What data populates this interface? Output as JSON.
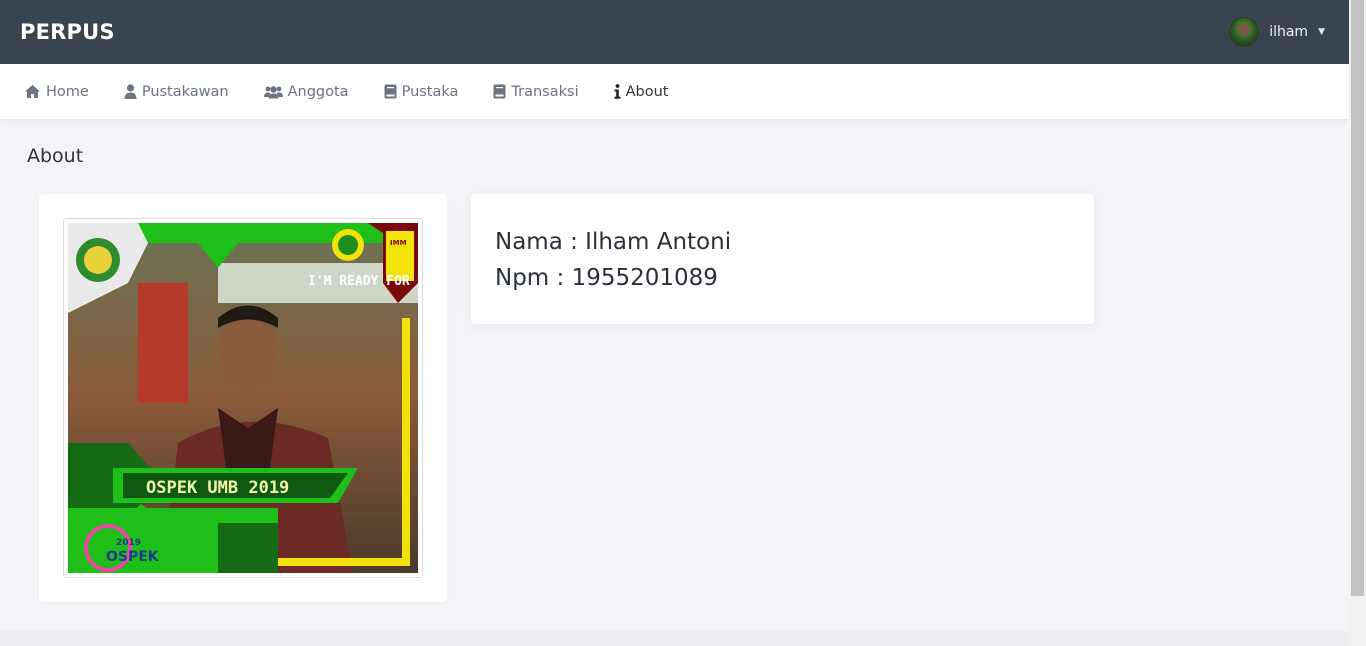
{
  "app": {
    "brand": "PERPUS"
  },
  "user": {
    "name": "ilham",
    "avatar_icon": "user-avatar",
    "dropdown_icon": "chevron-down-icon"
  },
  "nav": {
    "items": [
      {
        "label": "Home",
        "icon": "home-icon"
      },
      {
        "label": "Pustakawan",
        "icon": "user-icon"
      },
      {
        "label": "Anggota",
        "icon": "users-icon"
      },
      {
        "label": "Pustaka",
        "icon": "book-icon"
      },
      {
        "label": "Transaksi",
        "icon": "book-icon"
      },
      {
        "label": "About",
        "icon": "info-icon",
        "active": true
      }
    ]
  },
  "page": {
    "title": "About"
  },
  "profile": {
    "photo_text_top": "I'M READY FOR",
    "photo_banner": "OSPEK UMB 2019",
    "photo_logo_year": "2019",
    "photo_logo_text": "OSPEK",
    "photo_badge": "IMM",
    "nama": "Nama : Ilham Antoni",
    "npm": "Npm : 1955201089"
  },
  "colors": {
    "topbar": "#3a4450",
    "accent_green": "#2fbf1f",
    "frame_yellow": "#f1e20b"
  }
}
